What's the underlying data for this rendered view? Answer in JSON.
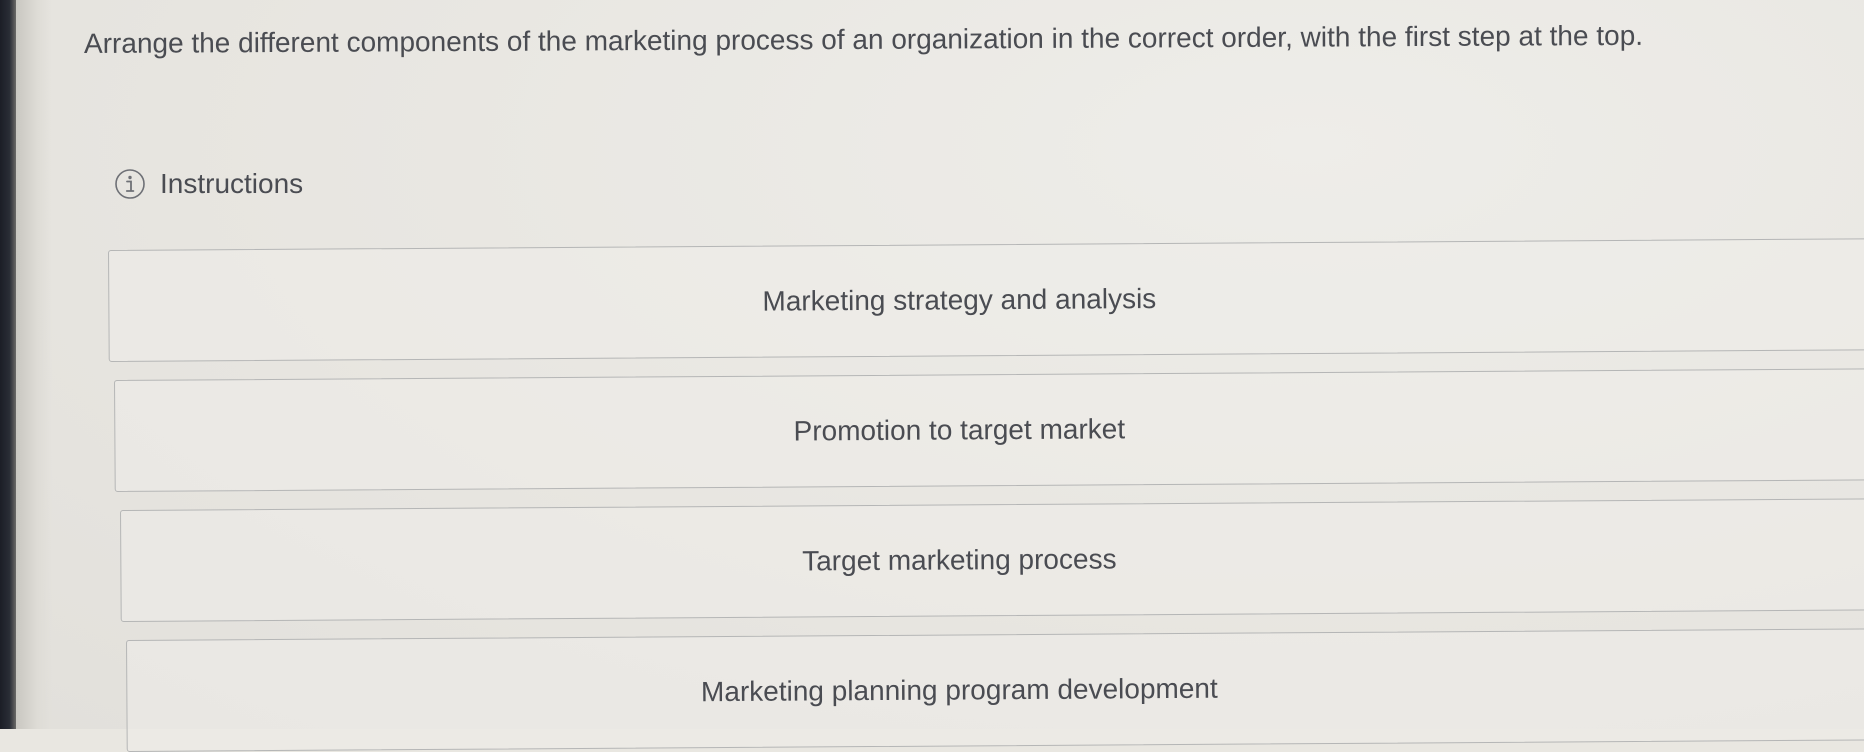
{
  "question": {
    "text": "Arrange the different components of the marketing process of an organization in the correct order, with the first step at the top."
  },
  "instructions": {
    "label": "Instructions",
    "icon": "info-icon"
  },
  "choices": [
    {
      "label": "Marketing strategy and analysis"
    },
    {
      "label": "Promotion to target market"
    },
    {
      "label": "Target marketing process"
    },
    {
      "label": "Marketing planning program development"
    }
  ],
  "colors": {
    "text": "#4a4c52",
    "border": "#b5b6b6",
    "background": "#e9e7e1"
  }
}
